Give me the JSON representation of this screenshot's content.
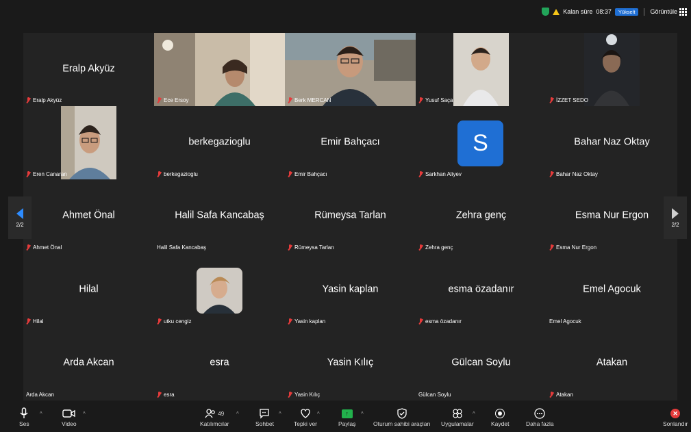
{
  "topbar": {
    "remaining_label": "Kalan süre",
    "remaining_time": "08:37",
    "upgrade_label": "Yükselt",
    "view_label": "Görüntüle"
  },
  "pager": {
    "left_label": "2/2",
    "right_label": "2/2"
  },
  "participants": [
    {
      "center": "Eralp Akyüz",
      "label": "Eralp Akyüz"
    },
    {
      "center": "",
      "label": "Ece Ersoy"
    },
    {
      "center": "",
      "label": "Berk MERCAN"
    },
    {
      "center": "",
      "label": "Yusuf Saça"
    },
    {
      "center": "",
      "label": "İZZET SEDO"
    },
    {
      "center": "",
      "label": "Eren Canaran"
    },
    {
      "center": "berkegazioglu",
      "label": "berkegazioglu"
    },
    {
      "center": "Emir Bahçacı",
      "label": "Emir Bahçacı"
    },
    {
      "center": "S",
      "label": "Sarkhan Aliyev"
    },
    {
      "center": "Bahar Naz Oktay",
      "label": "Bahar Naz Oktay"
    },
    {
      "center": "Ahmet Önal",
      "label": "Ahmet Önal"
    },
    {
      "center": "Halil Safa Kancabaş",
      "label": "Halil Safa Kancabaş"
    },
    {
      "center": "Rümeysa Tarlan",
      "label": "Rümeysa Tarlan"
    },
    {
      "center": "Zehra genç",
      "label": "Zehra genç"
    },
    {
      "center": "Esma Nur Ergon",
      "label": "Esma Nur Ergon"
    },
    {
      "center": "Hilal",
      "label": "Hilal"
    },
    {
      "center": "",
      "label": "utku cengiz"
    },
    {
      "center": "Yasin kaplan",
      "label": "Yasin kaplan"
    },
    {
      "center": "esma özadanır",
      "label": "esma özadanır"
    },
    {
      "center": "Emel Agocuk",
      "label": "Emel Agocuk"
    },
    {
      "center": "Arda Akcan",
      "label": "Arda Akcan"
    },
    {
      "center": "esra",
      "label": "esra"
    },
    {
      "center": "Yasin Kılıç",
      "label": "Yasin Kılıç"
    },
    {
      "center": "Gülcan Soylu",
      "label": "Gülcan Soylu"
    },
    {
      "center": "Atakan",
      "label": "Atakan"
    }
  ],
  "toolbar": {
    "audio": "Ses",
    "video": "Video",
    "participants": "Katılımcılar",
    "participant_count": "49",
    "chat": "Sohbet",
    "react": "Tepki ver",
    "share": "Paylaş",
    "host_tools": "Oturum sahibi araçları",
    "apps": "Uygulamalar",
    "record": "Kaydet",
    "more": "Daha fazla",
    "end": "Sonlandır"
  },
  "colors": {
    "accent": "#2d8cff",
    "muted": "#e53b3b",
    "share": "#22b14c",
    "upgrade": "#1f6fd4"
  }
}
